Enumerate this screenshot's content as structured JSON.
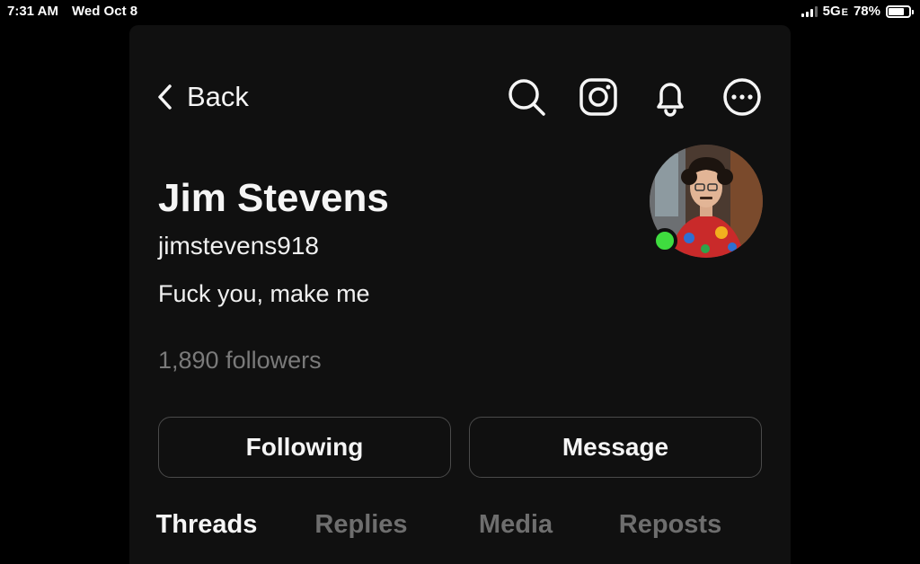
{
  "status_bar": {
    "time": "7:31 AM",
    "date": "Wed Oct 8",
    "network": "5G",
    "network_suffix": "E",
    "battery": "78%"
  },
  "header": {
    "back_label": "Back",
    "icons": [
      "search-icon",
      "instagram-icon",
      "bell-icon",
      "more-icon"
    ]
  },
  "profile": {
    "name": "Jim Stevens",
    "handle": "jimstevens918",
    "bio": "Fuck you, make me",
    "followers": "1,890 followers",
    "online": true,
    "online_color": "#3fdc3f"
  },
  "actions": {
    "following_label": "Following",
    "message_label": "Message"
  },
  "tabs": [
    {
      "label": "Threads",
      "active": true
    },
    {
      "label": "Replies",
      "active": false
    },
    {
      "label": "Media",
      "active": false
    },
    {
      "label": "Reposts",
      "active": false
    }
  ]
}
